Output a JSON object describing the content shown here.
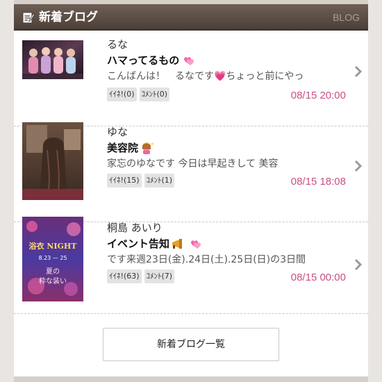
{
  "header": {
    "title": "新着ブログ",
    "right_label": "BLOG",
    "icon": "edit-note-icon"
  },
  "entries": [
    {
      "author": "るな",
      "title": "ハマってるもの",
      "title_icons": [
        "pink-hearts-icon"
      ],
      "excerpt": "こんばんは！　るなです💗ちょっと前にやっ",
      "likes": "ｲｲﾈ!(0)",
      "comments": "ｺﾒﾝﾄ(0)",
      "date": "08/15 20:00"
    },
    {
      "author": "ゆな",
      "title": "美容院",
      "title_icons": [
        "hair-salon-icon"
      ],
      "excerpt": "家忘のゆなです 今日は早起きして 美容",
      "likes": "ｲｲﾈ!(15)",
      "comments": "ｺﾒﾝﾄ(1)",
      "date": "08/15 18:08"
    },
    {
      "author": "桐島 あいり",
      "title": "イベント告知",
      "title_icons": [
        "megaphone-icon",
        "pink-hearts-icon"
      ],
      "excerpt": "です来週23日(金).24日(土).25日(日)の3日間",
      "likes": "ｲｲﾈ!(63)",
      "comments": "ｺﾒﾝﾄ(7)",
      "date": "08/15 00:00",
      "thumb_text": {
        "line1": "浴衣 NIGHT",
        "line2": "8.23 — 25",
        "line3": "夏の",
        "line4": "粋な装い"
      }
    }
  ],
  "more_button": "新着ブログ一覧",
  "colors": {
    "header_bg": "#5a4c43",
    "date": "#c94f86",
    "tag_bg": "#e3e3e3"
  }
}
